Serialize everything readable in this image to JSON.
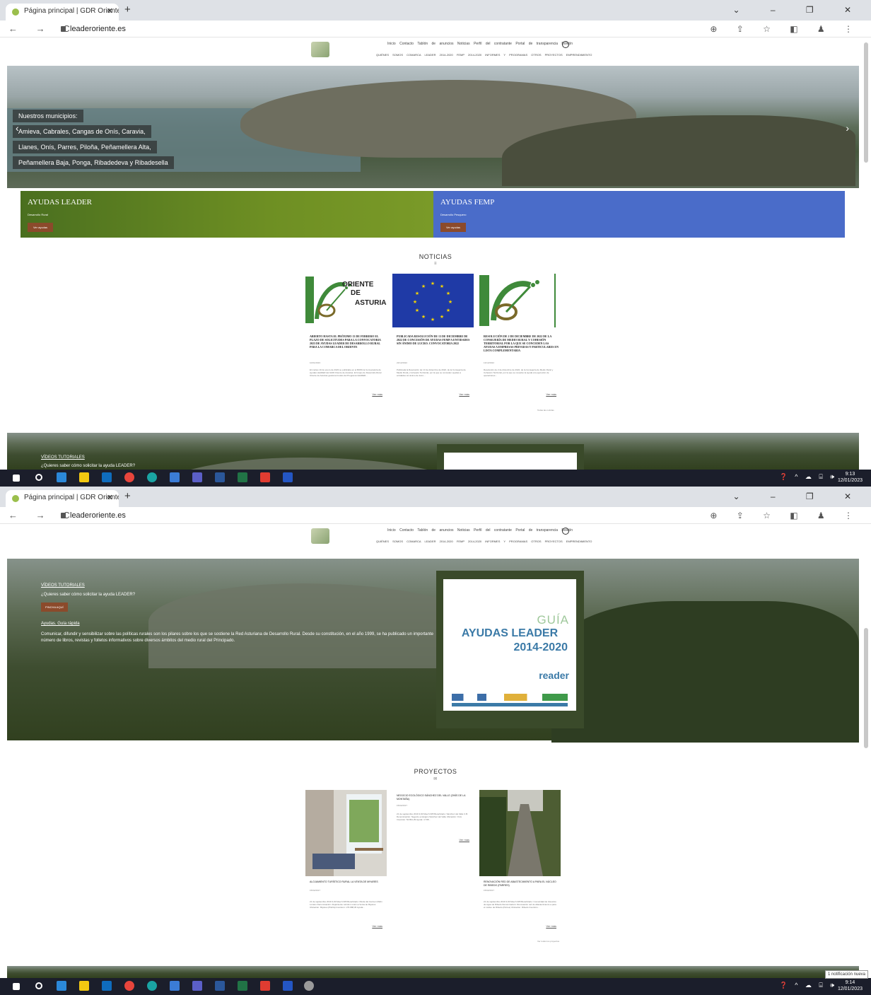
{
  "browser": {
    "tab_title": "Página principal | GDR Oriente d",
    "tab_close": "✕",
    "new_tab": "+",
    "window_controls": "⌄ – ❐ ✕",
    "nav_buttons": "← → C",
    "url": "leaderoriente.es",
    "right_icons": "⊕ ⇪ ☆ ◧ ♟ ⋮"
  },
  "site": {
    "menu_primary": [
      "Inicio",
      "Contacto",
      "Tablón de anuncios",
      "Noticias",
      "Perfil del contratante",
      "Portal de transparencia",
      "Boletín"
    ],
    "menu_secondary": [
      "QUIÉNES SOMOS",
      "COMARCA",
      "LEADER 2014-2020",
      "FEMP 2014-2020",
      "INFORMES Y PROGRAMAS",
      "OTROS PROYECTOS",
      "EMPRENDIMIENTO"
    ]
  },
  "hero": {
    "captions": [
      "Nuestros municipios:",
      "Amieva, Cabrales, Cangas de Onís, Caravia,",
      "Llanes, Onís, Parres, Piloña, Peñamellera Alta,",
      "Peñamellera Baja, Ponga, Ribadedeva y Ribadesella"
    ],
    "prev": "‹",
    "next": "›"
  },
  "ayudas": [
    {
      "title": "AYUDAS LEADER",
      "subtitle": "Desarrollo Rural",
      "button": "Ver ayudas",
      "color": "#6e8f23"
    },
    {
      "title": "AYUDAS FEMP",
      "subtitle": "Desarrollo Pesquero",
      "button": "Ver ayudas",
      "color": "#4a6cc9"
    }
  ],
  "noticias": {
    "title": "NOTICIAS",
    "icon": "≡",
    "items": [
      {
        "title": "ABIERTO HASTA EL PRÓXIMO 13 DE FEBRERO EL PLAZO DE SOLICITUDES PARA LA CONVOCATORIA 2023 DE AYUDAS LEADER DE DESARROLLO RURAL PARA LA COMARCA DEL ORIENTE",
        "date": "10/01/2023",
        "body": "El martes 10 de enero de 2023 se publicaba en el BOPA la Convocatoria de ayudas LEADER del GDR Oriente de Asturias. El Grupo de Desarrollo Rural Oriente de Asturias gestiona fondos del Programa LEADER...",
        "more": "Ver más",
        "logo_lines": [
          "ORIENTE",
          "DE",
          "ASTURIAS"
        ]
      },
      {
        "title": "PUBLICADA RESOLUCIÓN DE 13 DE DICIEMBRE DE 2022 DE CONCESIÓN DE AYUDAS FEMP A ENTIDADES SIN ÁNIMO DE LUCRO. CONVOCATORIA 2022",
        "date": "22/12/2022",
        "body": "Publicada la Resolución de 13 de diciembre de 2022, de la Consejería de Medio Rural y Cohesión Territorial, por la que se conceden ayudas a entidades sin ánimo de lucro...",
        "more": "Ver más",
        "logo_lines": []
      },
      {
        "title": "RESOLUCIÓN DE 2 DE DICIEMBRE DE 2022 DE LA CONSEJERÍA DE MEDIO RURAL Y COHESIÓN TERRITORIAL POR LA QUE SE CONCEDEN LAS AYUDAS A EMPRESAS PRIVADAS Y PARTICULARES EN LISTA COMPLEMENTARIA",
        "date": "13/12/2022",
        "body": "Resolución de 2 de diciembre de 2022, de la Consejería de Medio Rural y Cohesión Territorial, por la que se resuelve la ayuda a la ejecución de operaciones...",
        "more": "Ver más",
        "logo_lines": []
      }
    ],
    "all_news": "Todas las noticias"
  },
  "videos": {
    "link": "VÍDEOS TUTORIALES",
    "question": "¿Quieres saber cómo solicitar la ayuda LEADER?",
    "button": "PINCHA AQUÍ",
    "guia_link": "Ayudas. Guía rápida",
    "comunicar": "Comunicar, difundir y sensibilizar sobre las políticas rurales son los pilares sobre los que se sostiene la Red Asturiana de Desarrollo Rural. Desde su constitución, en el año 1999, se ha publicado un importante número de libros, revistas y folletos informativos sobre diversos ámbitos del medio rural del Principado."
  },
  "guia": {
    "line1": "GUÍA",
    "line2": "AYUDAS LEADER",
    "line3": "2014-2020",
    "brand": "reader"
  },
  "proyectos": {
    "title": "PROYECTOS",
    "icon": "✉",
    "items": [
      {
        "title": "ALOJAMIENTO TURÍSTICO RURAL LA VENTA DE MIYARES",
        "date": "15/02/2017",
        "body": "21 de septiembre 2019 3,90 Mea 6.305 Beneficiario: María del Carmen Mdrm Lozano Denominación: Alojamiento turístico rural La Venta de Miyares Ubicación: Miyares (Piloña) Inversión: 179.688,45 Ayuda...",
        "more": "Ver más"
      },
      {
        "title": "NEGOCIO ECOLÓGICO SÁNCHEZ DEL VALLE (ONÍS DE LA MONTAÑA)",
        "date": "15/02/2017",
        "body": "21 de septiembre 2019 3,90 Mea 6.305 Beneficiario: Sánchez del Valle C.B. Denominación: Negocio ecológico Sánchez del Valle Ubicación: Onís Inversión: 54.891,39 Ayuda: 4.738...",
        "more": "Ver más"
      },
      {
        "title": "RENOVACIÓN RED DE ABASTECIMIENTO A PARA EL NÚCLEO DE RIBEDO (PARRES)",
        "date": "15/02/2017",
        "body": "21 de septiembre 2019 3,90 Mea 6.305 Beneficiario: Comunidad de Usuarios de Agua de Ribedo Denominación: Renovación red de abastecimiento a para el núcleo de Ribedo (Parres) Ubicación: Ribedo Inversión...",
        "more": "Ver más"
      }
    ],
    "all_projects": "Ver todos los proyectos"
  },
  "taskbar": [
    {
      "time": "9:13",
      "date": "12/01/2023"
    },
    {
      "time": "9:14",
      "date": "12/01/2023"
    }
  ],
  "tray": "❓ ^ ☁ ⌸ 🕪",
  "notification": "1 notificación nueva",
  "colors": {
    "leader_green": "#6e8f23",
    "femp_blue": "#4a6cc9",
    "button_brown": "#8b4a2b",
    "eu_blue": "#1f3aa6",
    "eu_star": "#f5d400"
  }
}
